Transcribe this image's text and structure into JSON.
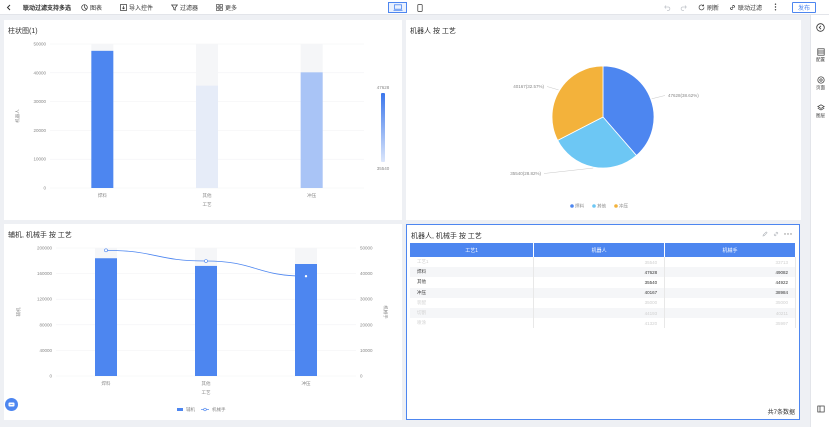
{
  "toolbar": {
    "back_icon": "chevron-left-icon",
    "title": "联动过滤支持多选",
    "chart_label": "图表",
    "import_label": "导入控件",
    "filter_label": "过滤器",
    "more_label": "更多",
    "refresh_label": "刷新",
    "linkage_label": "联动过滤",
    "publish_label": "发布"
  },
  "right_sidebar": {
    "config_label": "配置",
    "page_label": "页面",
    "layer_label": "图层"
  },
  "panels": {
    "bar1_title": "柱状图(1)",
    "pie_title": "机器人 按 工艺",
    "combo_title": "辅机, 机械手 按 工艺",
    "table_title": "机器人, 机械手 按 工艺",
    "table_footer": "共7条数据"
  },
  "colors": {
    "accent": "#4d86f0",
    "light_blue": "#6dc7f4",
    "orange": "#f3b23b"
  },
  "chart_data": [
    {
      "type": "bar",
      "title": "柱状图(1)",
      "categories": [
        "焊料",
        "其他",
        "冲压"
      ],
      "values": [
        47628,
        35540,
        40167
      ],
      "ylim": [
        0,
        50000
      ],
      "yticks": [
        "0",
        "10000",
        "20000",
        "30000",
        "40000",
        "50000"
      ],
      "ylabel": "机器人",
      "xlabel": "工艺",
      "visual_map": {
        "max": "47628",
        "min": "35540"
      }
    },
    {
      "type": "pie",
      "title": "机器人 按 工艺",
      "slices": [
        {
          "name": "焊料",
          "value": 47628,
          "label": "47628(38.62%)",
          "color": "#4d86f0"
        },
        {
          "name": "其他",
          "value": 35540,
          "label": "35540(28.82%)",
          "color": "#6dc7f4"
        },
        {
          "name": "冲压",
          "value": 40167,
          "label": "40167(32.57%)",
          "color": "#f3b23b"
        }
      ],
      "legend": [
        "焊料",
        "其他",
        "冲压"
      ],
      "legend_position": "bottom"
    },
    {
      "type": "bar",
      "title": "辅机, 机械手 按 工艺",
      "categories": [
        "焊料",
        "其他",
        "冲压"
      ],
      "series": [
        {
          "name": "辅机",
          "type": "bar",
          "values": [
            184000,
            172000,
            175000
          ]
        },
        {
          "name": "机械手",
          "type": "line",
          "values": [
            49082,
            44922,
            38984
          ]
        }
      ],
      "ylim_left": [
        0,
        200000
      ],
      "yticks_left": [
        "0",
        "40000",
        "80000",
        "120000",
        "160000",
        "200000"
      ],
      "ylim_right": [
        0,
        50000
      ],
      "yticks_right": [
        "0",
        "10000",
        "20000",
        "30000",
        "40000",
        "50000"
      ],
      "ylabel_left": "辅机",
      "ylabel_right": "机械手",
      "xlabel": "工艺",
      "legend_position": "bottom"
    },
    {
      "type": "table",
      "title": "机器人, 机械手 按 工艺",
      "columns": [
        "工艺1",
        "机器人",
        "机械手"
      ],
      "rows": [
        {
          "cells": [
            "工艺1",
            "35540",
            "33713"
          ],
          "faded": true
        },
        {
          "cells": [
            "焊料",
            "47628",
            "49082"
          ],
          "faded": false
        },
        {
          "cells": [
            "其他",
            "35540",
            "44922"
          ],
          "faded": false
        },
        {
          "cells": [
            "冲压",
            "40167",
            "38984"
          ],
          "faded": false
        },
        {
          "cells": [
            "装配",
            "35000",
            "35000"
          ],
          "faded": true
        },
        {
          "cells": [
            "切割",
            "44193",
            "40211"
          ],
          "faded": true
        },
        {
          "cells": [
            "喷涂",
            "41320",
            "35997"
          ],
          "faded": true
        }
      ]
    }
  ]
}
